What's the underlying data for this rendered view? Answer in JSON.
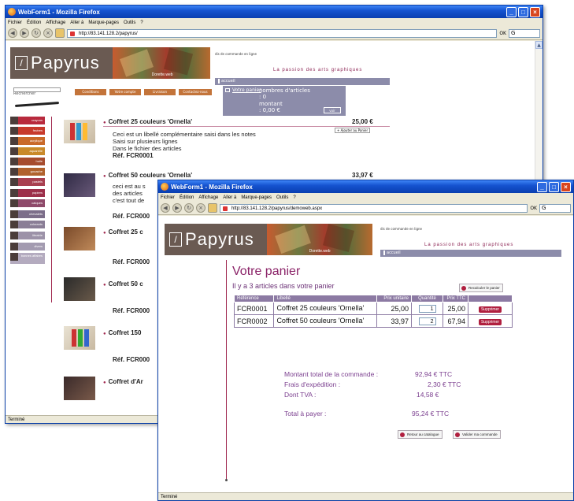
{
  "back_window": {
    "title": "WebForm1 - Mozilla Firefox",
    "menu": [
      "Fichier",
      "Édition",
      "Affichage",
      "Aller à",
      "Marque-pages",
      "Outils",
      "?"
    ],
    "url": "http://83.141.128.2/papyrus/",
    "go_label": "OK",
    "status": "Terminé",
    "site": {
      "logo": "Papyrus",
      "banner_label": "Dorette.web",
      "top_line": "dis de commande en ligne",
      "tagline": "La passion des arts graphiques",
      "accueil": "accueil",
      "search_label": "Rechercher",
      "tabs": [
        "Conditions",
        "Votre compte",
        "Livraison",
        "Contactez-nous"
      ],
      "panier": {
        "link": "Votre panier",
        "nb_label": "nombres d'articles",
        "nb_value": ": 0",
        "montant_label": "montant",
        "montant_value": ": 0,00 €",
        "btn": "voir"
      },
      "nav": [
        "crayons",
        "feutres",
        "acrylique",
        "aquarelle",
        "huile",
        "gouache",
        "pastels",
        "papiers",
        "calques",
        "chevalets",
        "colorants",
        "librairie",
        "divers",
        "bonnes affaires"
      ],
      "products": [
        {
          "title": "Coffret 25 couleurs 'Ornella'",
          "price": "25,00 €",
          "desc": [
            "Ceci est un libellé complémentaire saisi dans les notes",
            "Saisi sur plusieurs lignes",
            "Dans le fichier des articles"
          ],
          "ref": "Réf. FCR0001",
          "add": "+ Ajouter au Panier"
        },
        {
          "title": "Coffret 50 couleurs 'Ornella'",
          "price": "33,97 €",
          "desc": [
            "ceci est au s",
            "des articles",
            "c'est tout de"
          ],
          "ref": "Réf. FCR000"
        },
        {
          "title": "Coffret 25 c",
          "ref": "Réf. FCR000"
        },
        {
          "title": "Coffret 50 c",
          "ref": "Réf. FCR000"
        },
        {
          "title": "Coffret 150",
          "ref": "Réf. FCR000"
        },
        {
          "title": "Coffret d'Ar"
        }
      ]
    }
  },
  "front_window": {
    "title": "WebForm1 - Mozilla Firefox",
    "menu": [
      "Fichier",
      "Édition",
      "Affichage",
      "Aller à",
      "Marque-pages",
      "Outils",
      "?"
    ],
    "url": "http://83.141.128.2/papyrus/demoweb.aspx",
    "go_label": "OK",
    "status": "Terminé",
    "site": {
      "logo": "Papyrus",
      "banner_label": "Dorette.web",
      "top_line": "dis de commande en ligne",
      "tagline": "La passion des arts graphiques",
      "accueil": "accueil"
    },
    "cart": {
      "title": "Votre panier",
      "subtitle": "Il y a 3 articles dans votre panier",
      "recalc": "Recalculer le panier",
      "headers": [
        "Référence",
        "Libellé",
        "Prix unitaire",
        "Quantité",
        "Prix TTC",
        ""
      ],
      "rows": [
        {
          "ref": "FCR0001",
          "label": "Coffret 25 couleurs 'Ornella'",
          "unit": "25,00",
          "qty": "1",
          "total": "25,00",
          "del": "Supprimer"
        },
        {
          "ref": "FCR0002",
          "label": "Coffret 50 couleurs 'Ornella'",
          "unit": "33,97",
          "qty": "2",
          "total": "67,94",
          "del": "Supprimer"
        }
      ],
      "totals": {
        "order_label": "Montant total de la commande :",
        "order_value": "92,94 € TTC",
        "ship_label": "Frais d'expédition :",
        "ship_value": "2,30 € TTC",
        "tva_label": "Dont TVA :",
        "tva_value": "14,58 €",
        "pay_label": "Total à payer :",
        "pay_value": "95,24 € TTC"
      },
      "back_btn": "Retour au catalogue",
      "validate_btn": "Valider ma commande"
    }
  }
}
